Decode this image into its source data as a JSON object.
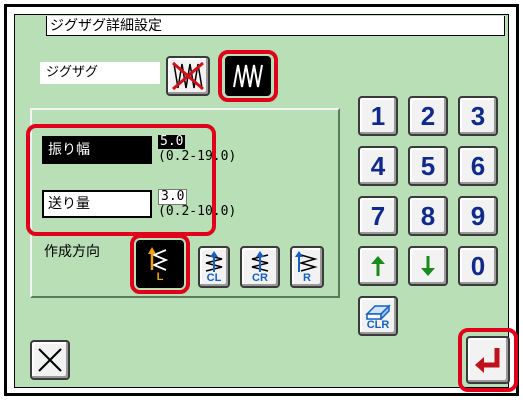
{
  "window": {
    "title": "ジグザグ詳細設定"
  },
  "zigzag": {
    "label": "ジグザグ",
    "options": [
      {
        "name": "zigzag-off",
        "icon": "zigzag-off-icon",
        "selected": false
      },
      {
        "name": "zigzag-on",
        "icon": "zigzag-on-icon",
        "selected": true
      }
    ]
  },
  "amplitude": {
    "label": "振り幅",
    "value": "5.0",
    "range": "(0.2-19.0)"
  },
  "feed": {
    "label": "送り量",
    "value": "3.0",
    "range": "(0.2-10.0)"
  },
  "direction": {
    "label": "作成方向",
    "options": [
      {
        "caption": "L",
        "selected": true
      },
      {
        "caption": "CL",
        "selected": false
      },
      {
        "caption": "CR",
        "selected": false
      },
      {
        "caption": "R",
        "selected": false
      }
    ]
  },
  "keypad": {
    "keys": [
      "1",
      "2",
      "3",
      "4",
      "5",
      "6",
      "7",
      "8",
      "9",
      "0"
    ],
    "clear_label": "CLR"
  },
  "colors": {
    "background": "#b9dfb7",
    "highlight": "#e0001a",
    "digit": "#102a8c",
    "arrow_up": "#1a8a1a",
    "arrow_down": "#1a8a1a",
    "enter": "#c0101a"
  }
}
